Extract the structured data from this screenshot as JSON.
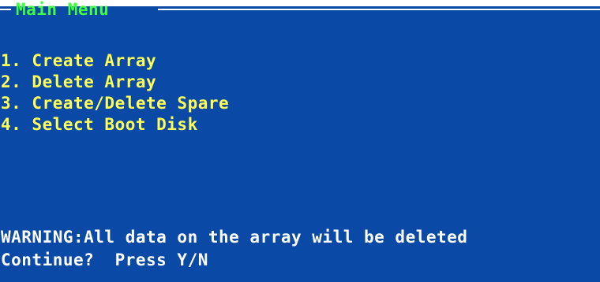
{
  "screen": {
    "title": "Main Menu",
    "colors": {
      "background": "#0a4aa6",
      "title": "#40ff40",
      "menu_text": "#ffff55",
      "message_text": "#ffffff"
    }
  },
  "menu": {
    "items": [
      {
        "label": "1. Create Array"
      },
      {
        "label": "2. Delete Array"
      },
      {
        "label": "3. Create/Delete Spare"
      },
      {
        "label": "4. Select Boot Disk"
      }
    ]
  },
  "messages": {
    "warning": "WARNING:All data on the array will be deleted",
    "prompt": "Continue?  Press Y/N"
  }
}
